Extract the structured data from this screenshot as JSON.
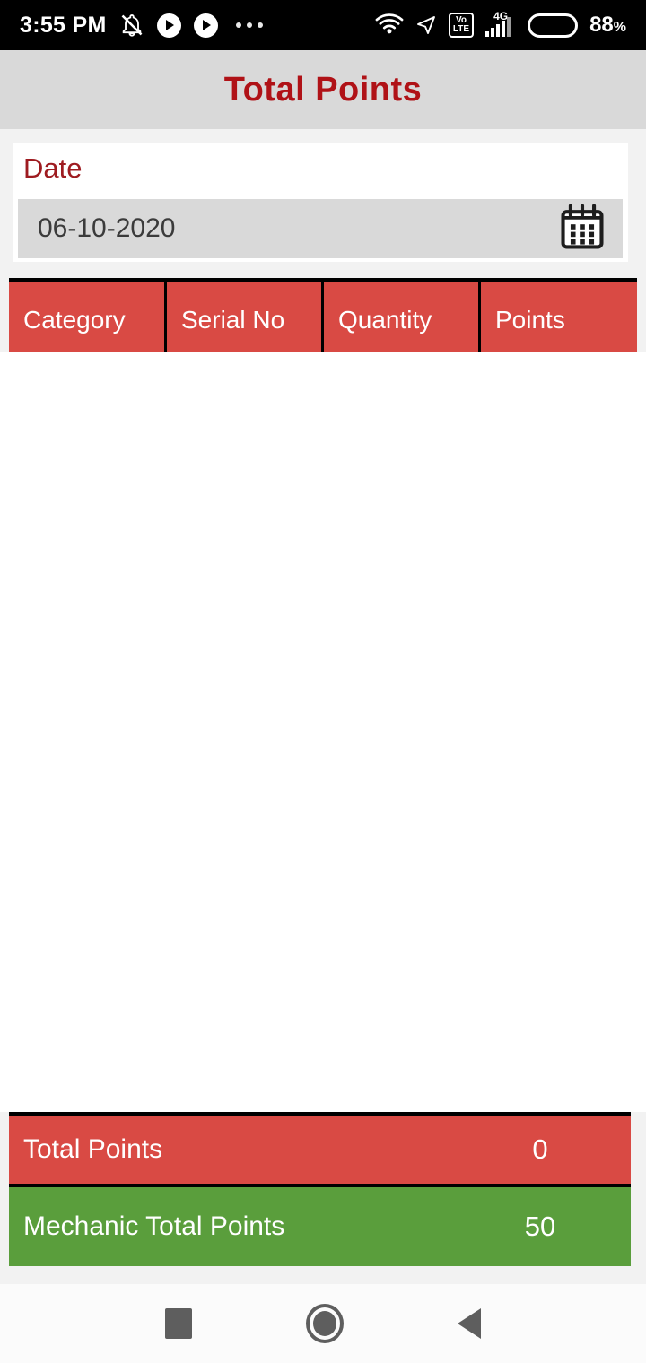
{
  "statusbar": {
    "time": "3:55 PM",
    "icons_left": [
      "mute-bell-icon",
      "play-circle-icon",
      "play-circle-icon",
      "overflow-dots-icon"
    ],
    "icons_right": [
      "wifi-icon",
      "location-arrow-icon",
      "volte-icon",
      "signal-4g-icon",
      "battery-icon"
    ],
    "volte_top": "Vo",
    "volte_bottom": "LTE",
    "network_type": "4G",
    "battery_level": "88",
    "battery_percent_symbol": "%"
  },
  "header": {
    "title": "Total Points",
    "title_color": "#b01217",
    "background": "#d9d9d9"
  },
  "date_card": {
    "label": "Date",
    "value": "06-10-2020",
    "calendar_icon": "calendar-icon"
  },
  "table": {
    "columns": [
      "Category",
      "Serial No",
      "Quantity",
      "Points"
    ],
    "rows": [],
    "header_background": "#d94a44",
    "header_text_color": "#ffffff",
    "body_background": "#ffffff"
  },
  "totals": [
    {
      "label": "Total Points",
      "value": "0",
      "color": "#d94a44"
    },
    {
      "label": "Mechanic Total Points",
      "value": "50",
      "color": "#5a9e3c"
    }
  ],
  "navbar": {
    "recents": "recents-square-icon",
    "home": "home-circle-icon",
    "back": "back-triangle-icon"
  }
}
